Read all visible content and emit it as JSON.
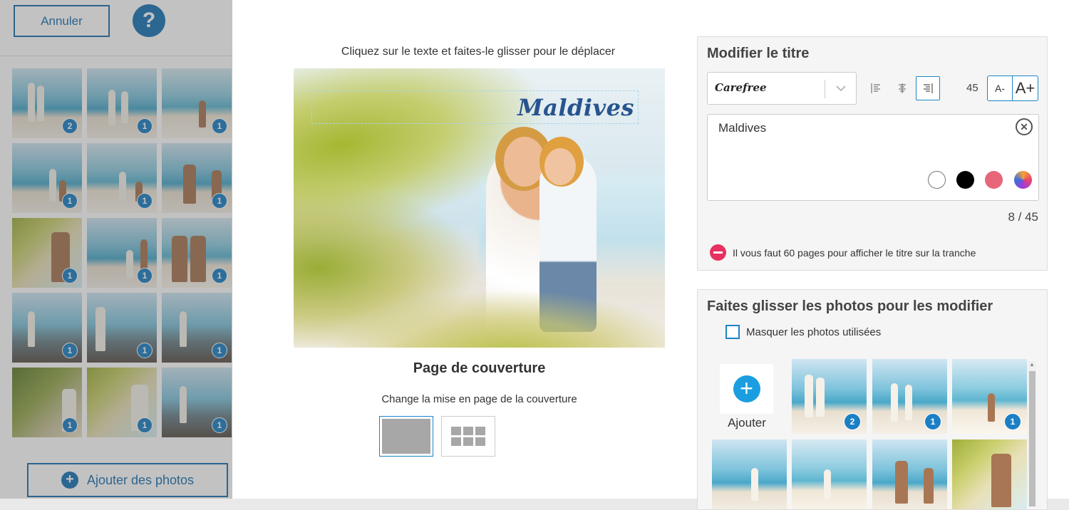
{
  "background": {
    "cancel_label": "Annuler",
    "help_label": "?",
    "add_photos_label": "Ajouter des photos",
    "thumbnails": [
      {
        "scene": "beach",
        "badge": "2"
      },
      {
        "scene": "beach",
        "badge": "1"
      },
      {
        "scene": "beach2",
        "badge": "1"
      },
      {
        "scene": "beach",
        "badge": "1"
      },
      {
        "scene": "beach2",
        "badge": "1"
      },
      {
        "scene": "beach",
        "badge": "1"
      },
      {
        "scene": "palm",
        "badge": "1"
      },
      {
        "scene": "beach",
        "badge": "1"
      },
      {
        "scene": "beach2",
        "badge": "1"
      },
      {
        "scene": "pier",
        "badge": "1"
      },
      {
        "scene": "pier",
        "badge": "1"
      },
      {
        "scene": "pier",
        "badge": "1"
      },
      {
        "scene": "jungle",
        "badge": "1"
      },
      {
        "scene": "palm",
        "badge": "1"
      },
      {
        "scene": "pier",
        "badge": "1"
      }
    ]
  },
  "editor": {
    "hint": "Cliquez sur le texte et faites-le glisser pour le déplacer",
    "cover_title": "Maldives",
    "cover_label": "Page de couverture",
    "layout_label": "Change la mise en page de la couverture"
  },
  "title_panel": {
    "heading": "Modifier le titre",
    "font": "Carefree",
    "alignment": "right",
    "font_size": "45",
    "size_down_label": "A-",
    "size_up_label": "A+",
    "text_value": "Maldives",
    "colors": [
      "#ffffff",
      "#000000",
      "#e8667a",
      "gradient"
    ],
    "char_count": "8 / 45",
    "spine_warning": "Il vous faut 60 pages pour afficher le titre sur la tranche"
  },
  "photos_panel": {
    "heading": "Faites glisser les photos pour les modifier",
    "hide_used_label": "Masquer les photos utilisées",
    "add_label": "Ajouter",
    "photos": [
      {
        "scene": "beach",
        "badge": "2"
      },
      {
        "scene": "beach",
        "badge": "1"
      },
      {
        "scene": "beach2",
        "badge": "1"
      },
      {
        "scene": "beach",
        "badge": ""
      },
      {
        "scene": "beach2",
        "badge": ""
      },
      {
        "scene": "beach",
        "badge": ""
      },
      {
        "scene": "palm",
        "badge": ""
      }
    ]
  },
  "colors": {
    "accent": "#1b85c7",
    "badge": "#1b7fc4",
    "warning": "#e73160",
    "title_text": "#27548f"
  }
}
